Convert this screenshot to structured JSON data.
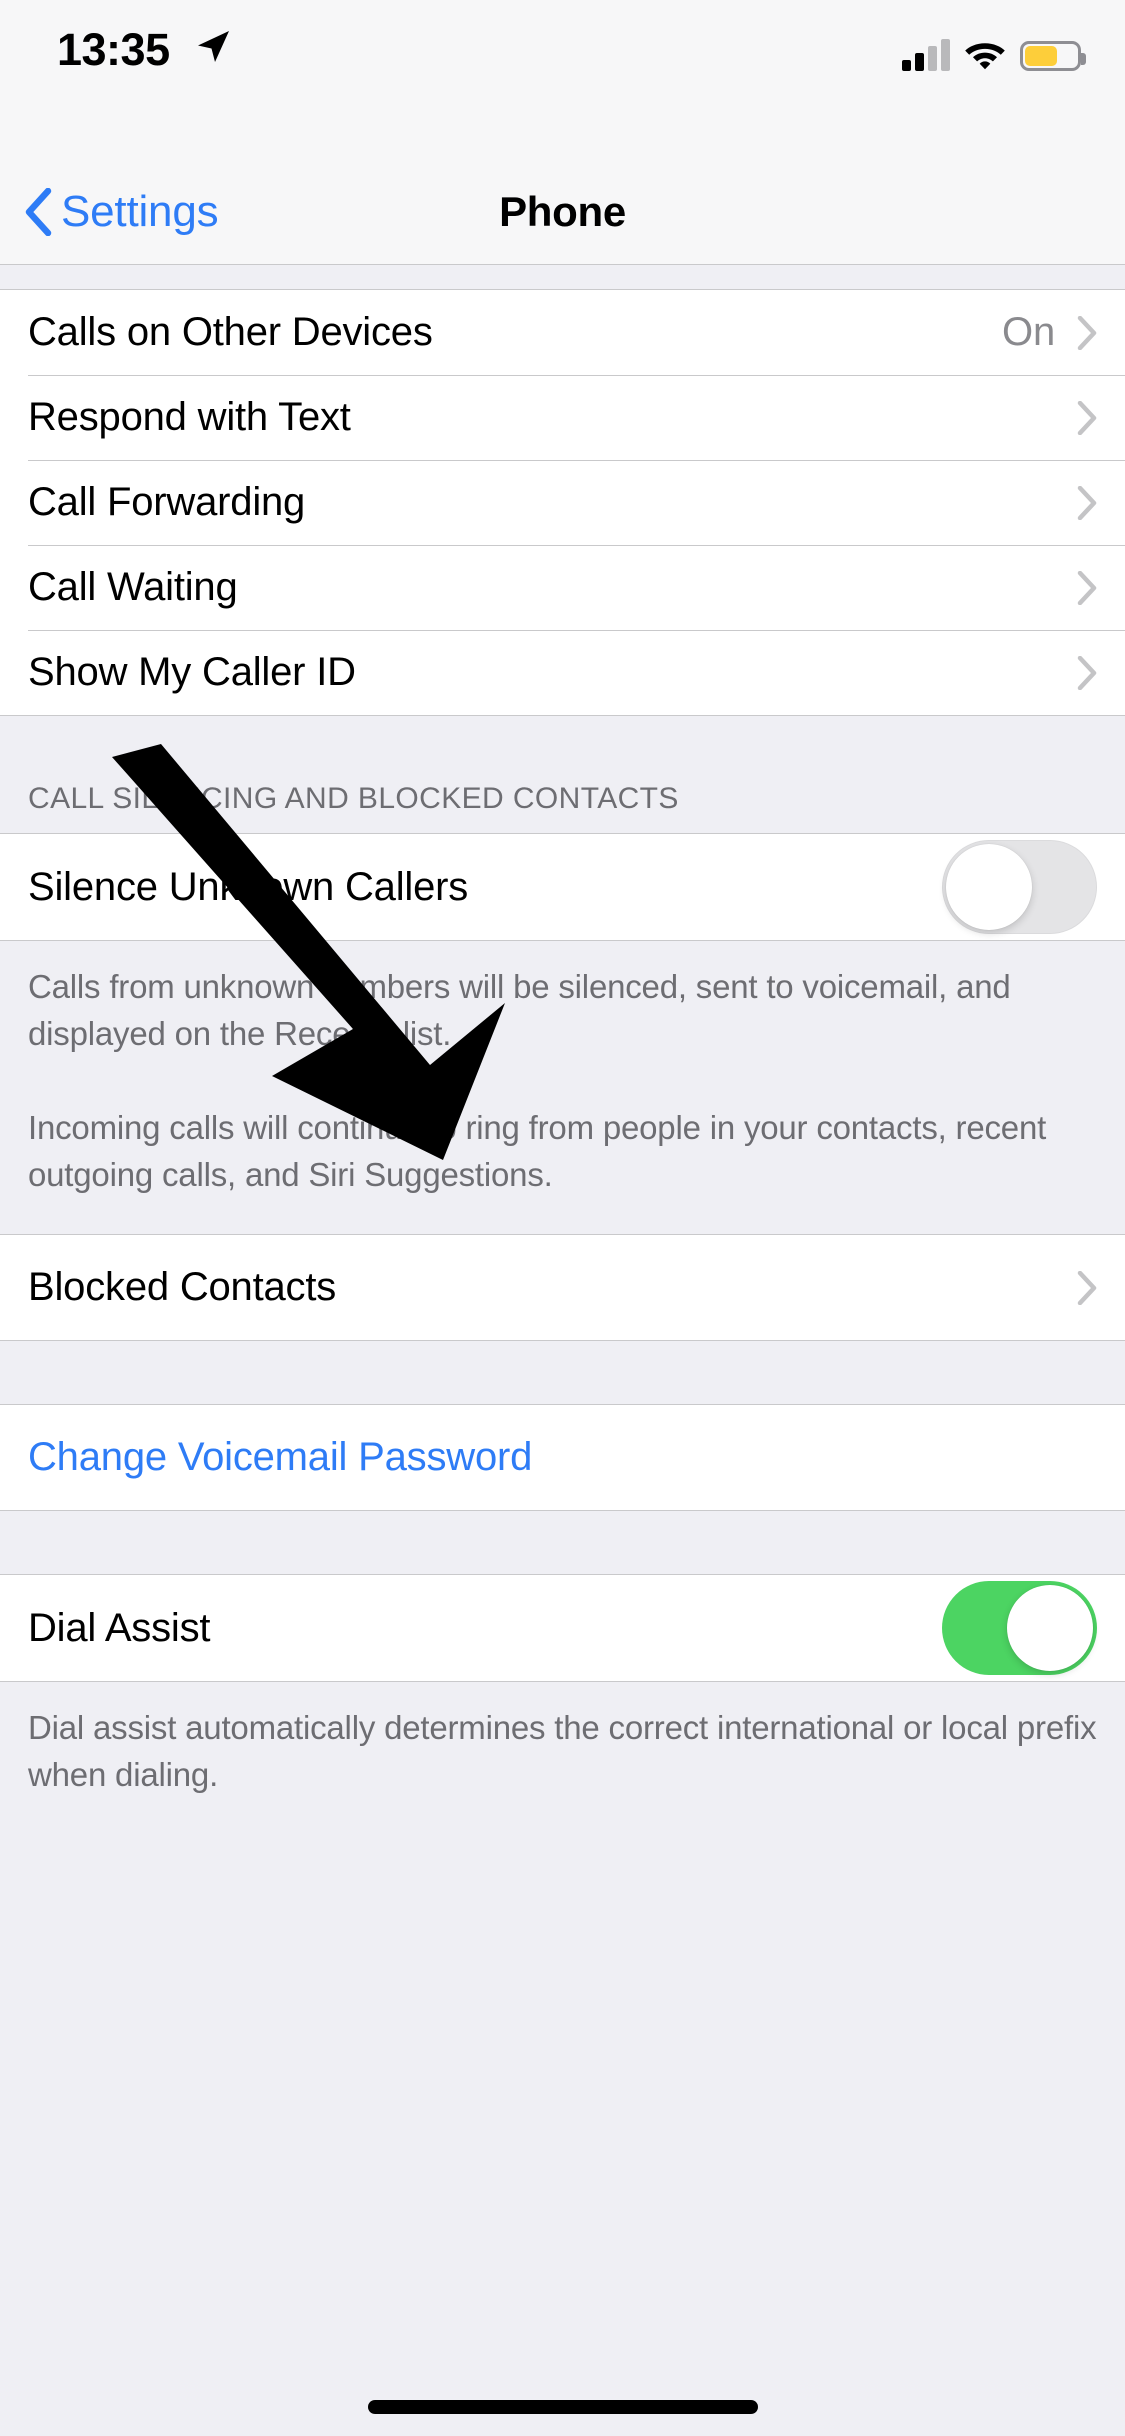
{
  "status_bar": {
    "time": "13:35",
    "location_icon": "location-arrow-icon",
    "cellular_icon": "cellular-signal-icon",
    "cellular_bars_filled": 2,
    "cellular_bars_total": 4,
    "wifi_icon": "wifi-icon",
    "battery_icon": "battery-icon",
    "battery_color": "#FDCE3A"
  },
  "nav_bar": {
    "back_label": "Settings",
    "back_icon": "chevron-left-icon",
    "title": "Phone",
    "tint_color": "#2E7CF6"
  },
  "sections": {
    "calls": {
      "rows": [
        {
          "label": "Calls on Other Devices",
          "value": "On",
          "accessory": "chevron-right-icon"
        },
        {
          "label": "Respond with Text",
          "value": "",
          "accessory": "chevron-right-icon"
        },
        {
          "label": "Call Forwarding",
          "value": "",
          "accessory": "chevron-right-icon"
        },
        {
          "label": "Call Waiting",
          "value": "",
          "accessory": "chevron-right-icon"
        },
        {
          "label": "Show My Caller ID",
          "value": "",
          "accessory": "chevron-right-icon"
        }
      ]
    },
    "silencing": {
      "header": "CALL SILENCING AND BLOCKED CONTACTS",
      "silence_unknown_callers": {
        "label": "Silence Unknown Callers",
        "toggle_state": "off"
      },
      "footer_paragraph_1": "Calls from unknown numbers will be silenced, sent to voicemail, and displayed on the Recents list.",
      "footer_paragraph_2": "Incoming calls will continue to ring from people in your contacts, recent outgoing calls, and Siri Suggestions.",
      "blocked_contacts": {
        "label": "Blocked Contacts",
        "accessory": "chevron-right-icon"
      }
    },
    "voicemail": {
      "change_password_label": "Change Voicemail Password"
    },
    "dial_assist": {
      "label": "Dial Assist",
      "toggle_state": "on",
      "toggle_on_color": "#4CD462",
      "footer": "Dial assist automatically determines the correct international or local prefix when dialing."
    }
  },
  "annotation": {
    "arrow_icon": "annotation-arrow-icon",
    "color": "#000000"
  },
  "home_indicator": "home-indicator"
}
